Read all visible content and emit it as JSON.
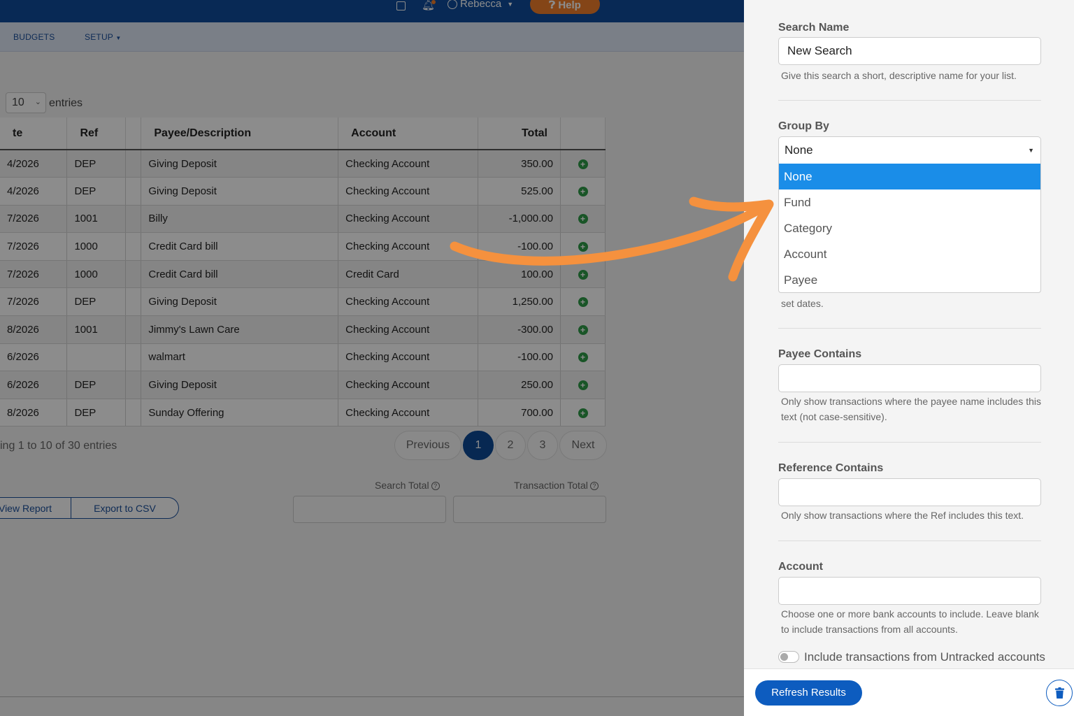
{
  "topbar": {
    "user_name": "Rebecca",
    "help_label": "Help"
  },
  "nav": {
    "budgets": "BUDGETS",
    "setup": "SETUP"
  },
  "entries": {
    "value": "10",
    "label": "entries"
  },
  "table": {
    "headers": [
      "te",
      "Ref",
      "",
      "Payee/Description",
      "Account",
      "Total",
      ""
    ],
    "rows": [
      {
        "date": "4/2026",
        "ref": "DEP",
        "payee": "Giving Deposit",
        "account": "Checking Account",
        "total": "350.00"
      },
      {
        "date": "4/2026",
        "ref": "DEP",
        "payee": "Giving Deposit",
        "account": "Checking Account",
        "total": "525.00"
      },
      {
        "date": "7/2026",
        "ref": "1001",
        "payee": "Billy",
        "account": "Checking Account",
        "total": "-1,000.00"
      },
      {
        "date": "7/2026",
        "ref": "1000",
        "payee": "Credit Card bill",
        "account": "Checking Account",
        "total": "-100.00"
      },
      {
        "date": "7/2026",
        "ref": "1000",
        "payee": "Credit Card bill",
        "account": "Credit Card",
        "total": "100.00"
      },
      {
        "date": "7/2026",
        "ref": "DEP",
        "payee": "Giving Deposit",
        "account": "Checking Account",
        "total": "1,250.00"
      },
      {
        "date": "8/2026",
        "ref": "1001",
        "payee": "Jimmy's Lawn Care",
        "account": "Checking Account",
        "total": "-300.00"
      },
      {
        "date": "6/2026",
        "ref": "",
        "payee": "walmart",
        "account": "Checking Account",
        "total": "-100.00"
      },
      {
        "date": "6/2026",
        "ref": "DEP",
        "payee": "Giving Deposit",
        "account": "Checking Account",
        "total": "250.00"
      },
      {
        "date": "8/2026",
        "ref": "DEP",
        "payee": "Sunday Offering",
        "account": "Checking Account",
        "total": "700.00"
      }
    ]
  },
  "pagination": {
    "showing": "ing 1 to 10 of 30 entries",
    "previous": "Previous",
    "pages": [
      "1",
      "2",
      "3"
    ],
    "active_page": "1",
    "next": "Next"
  },
  "totals": {
    "search_total_label": "Search Total",
    "transaction_total_label": "Transaction Total"
  },
  "report_buttons": {
    "view_report": "View Report",
    "export_csv": "Export to CSV"
  },
  "panel": {
    "search_name": {
      "label": "Search Name",
      "value": "New Search",
      "help": "Give this search a short, descriptive name for your list."
    },
    "group_by": {
      "label": "Group By",
      "selected": "None",
      "options": [
        "None",
        "Fund",
        "Category",
        "Account",
        "Payee"
      ]
    },
    "dates_help_tail": "set dates.",
    "payee_contains": {
      "label": "Payee Contains",
      "value": "",
      "help": "Only show transactions where the payee name includes this text (not case-sensitive)."
    },
    "reference_contains": {
      "label": "Reference Contains",
      "value": "",
      "help": "Only show transactions where the Ref includes this text."
    },
    "account": {
      "label": "Account",
      "value": "",
      "help": "Choose one or more bank accounts to include. Leave blank to include transactions from all accounts."
    },
    "untracked_label": "Include transactions from Untracked accounts",
    "untracked_on": false,
    "refresh_label": "Refresh Results"
  },
  "colors": {
    "brand_blue": "#0f4c9c",
    "help_orange": "#f07f2a",
    "selected_option": "#1a8de8",
    "annotation_arrow": "#f5913e",
    "plus_green": "#2e9b47"
  }
}
